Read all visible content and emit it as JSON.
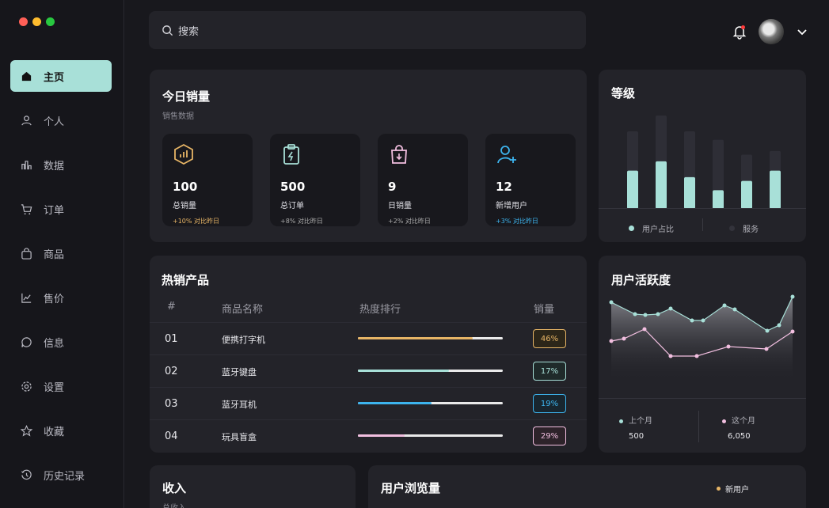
{
  "sidebar": {
    "items": [
      {
        "label": "主页",
        "icon": "home-icon",
        "active": true
      },
      {
        "label": "个人",
        "icon": "user-icon"
      },
      {
        "label": "数据",
        "icon": "bar-chart-icon"
      },
      {
        "label": "订单",
        "icon": "cart-icon"
      },
      {
        "label": "商品",
        "icon": "bag-icon"
      },
      {
        "label": "售价",
        "icon": "line-chart-icon"
      },
      {
        "label": "信息",
        "icon": "message-icon"
      },
      {
        "label": "设置",
        "icon": "settings-icon"
      },
      {
        "label": "收藏",
        "icon": "star-icon"
      },
      {
        "label": "历史记录",
        "icon": "history-icon"
      }
    ]
  },
  "header": {
    "search_placeholder": "搜索"
  },
  "sales": {
    "title": "今日销量",
    "subtitle": "销售数据",
    "stats": [
      {
        "value": "100",
        "label": "总销量",
        "change": "+10% 对比昨日",
        "color": "#e7b566"
      },
      {
        "value": "500",
        "label": "总订单",
        "change": "+8% 对比昨日",
        "color": "#a8e0d8"
      },
      {
        "value": "9",
        "label": "日销量",
        "change": "+2% 对比昨日",
        "color": "#f2bfe0"
      },
      {
        "value": "12",
        "label": "新增用户",
        "change": "+3% 对比昨日",
        "color": "#3db4ee"
      }
    ]
  },
  "level": {
    "title": "等级",
    "legend": [
      "用户占比",
      "服务"
    ],
    "bars": [
      {
        "bg": 0.83,
        "fg": 0.41
      },
      {
        "bg": 1.0,
        "fg": 0.51
      },
      {
        "bg": 0.83,
        "fg": 0.34
      },
      {
        "bg": 0.74,
        "fg": 0.2
      },
      {
        "bg": 0.58,
        "fg": 0.3
      },
      {
        "bg": 0.62,
        "fg": 0.41
      }
    ]
  },
  "products": {
    "title": "热销产品",
    "headers": [
      "#",
      "商品名称",
      "热度排行",
      "销量"
    ],
    "rows": [
      {
        "idx": "01",
        "name": "便携打字机",
        "pct": "46%",
        "fill": 0.79,
        "color": "#e7b566"
      },
      {
        "idx": "02",
        "name": "蓝牙键盘",
        "pct": "17%",
        "fill": 0.63,
        "color": "#a8e0d8"
      },
      {
        "idx": "03",
        "name": "蓝牙耳机",
        "pct": "19%",
        "fill": 0.51,
        "color": "#3db4ee"
      },
      {
        "idx": "04",
        "name": "玩具盲盒",
        "pct": "29%",
        "fill": 0.32,
        "color": "#f2bfe0"
      }
    ]
  },
  "activity": {
    "title": "用户活跃度",
    "last_month": {
      "label": "上个月",
      "value": "500",
      "color": "#a8e0d8"
    },
    "this_month": {
      "label": "这个月",
      "value": "6,050",
      "color": "#f2bfe0"
    }
  },
  "income": {
    "title": "收入",
    "subtitle": "总收入"
  },
  "views": {
    "title": "用户浏览量",
    "legend": "新用户"
  }
}
